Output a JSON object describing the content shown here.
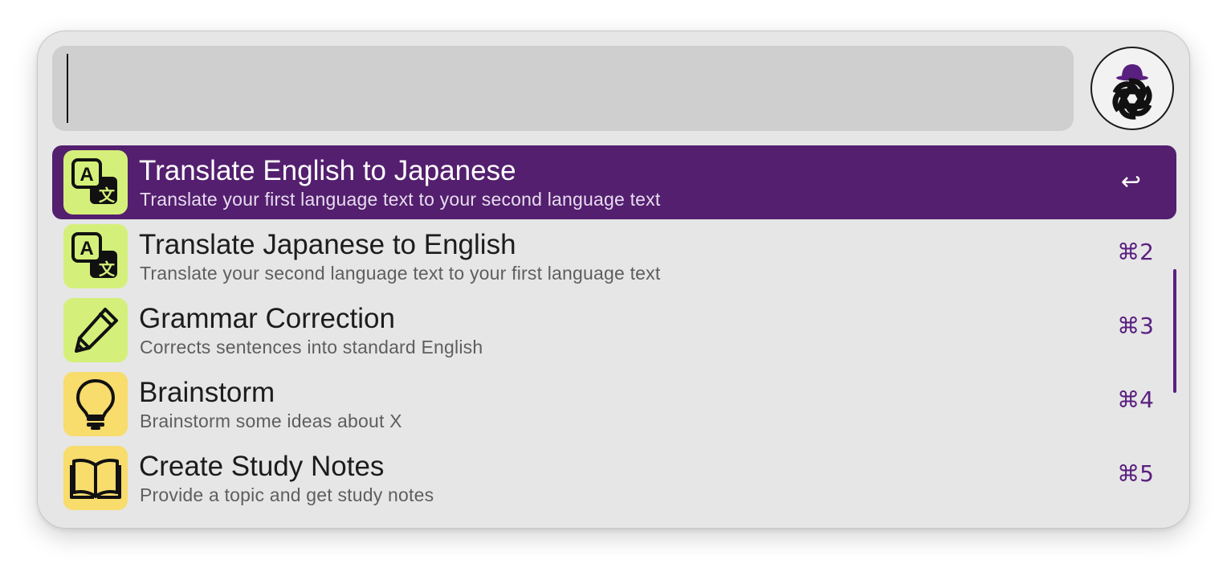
{
  "search": {
    "value": "",
    "placeholder": ""
  },
  "assistant_button": {
    "icon": "chatgpt-logo-with-hat-icon"
  },
  "colors": {
    "selected_row": "#531f6e",
    "accent": "#5a2080",
    "icon_green": "#d4f07a",
    "icon_yellow": "#f8dc6c"
  },
  "items": [
    {
      "title": "Translate English to Japanese",
      "subtitle": "Translate your first language text to your second language text",
      "shortcut": "↩",
      "icon": "translate-icon",
      "selected": true
    },
    {
      "title": "Translate Japanese to English",
      "subtitle": "Translate your second language text to your first language text",
      "shortcut": "⌘2",
      "icon": "translate-icon",
      "selected": false
    },
    {
      "title": "Grammar Correction",
      "subtitle": "Corrects sentences into standard English",
      "shortcut": "⌘3",
      "icon": "pencil-icon",
      "selected": false
    },
    {
      "title": "Brainstorm",
      "subtitle": "Brainstorm some ideas about X",
      "shortcut": "⌘4",
      "icon": "lightbulb-icon",
      "selected": false
    },
    {
      "title": "Create Study Notes",
      "subtitle": "Provide a topic and get study notes",
      "shortcut": "⌘5",
      "icon": "book-icon",
      "selected": false
    }
  ]
}
